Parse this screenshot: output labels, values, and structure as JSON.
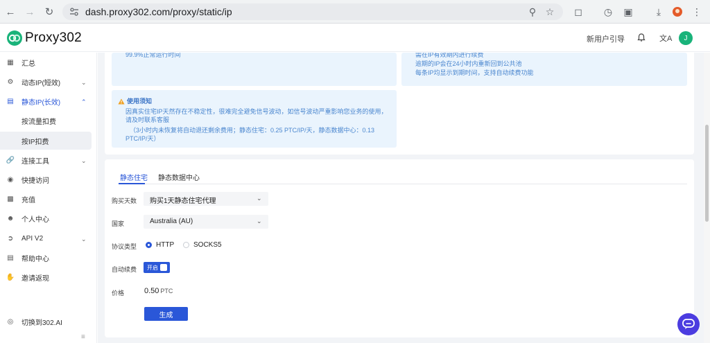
{
  "browser": {
    "url": "dash.proxy302.com/proxy/static/ip"
  },
  "header": {
    "logo_text": "Proxy302",
    "guide_label": "新用户引导",
    "lang_label": "文A",
    "avatar_letter": "J"
  },
  "sidebar": {
    "items": [
      {
        "label": "汇总"
      },
      {
        "label": "动态IP(短效)"
      },
      {
        "label": "静态IP(长效)"
      },
      {
        "label": "连接工具"
      },
      {
        "label": "快捷访问"
      },
      {
        "label": "充值"
      },
      {
        "label": "个人中心"
      },
      {
        "label": "API V2"
      },
      {
        "label": "帮助中心"
      },
      {
        "label": "邀请返现"
      }
    ],
    "sub_items": [
      {
        "label": "按流量扣费"
      },
      {
        "label": "按IP扣费"
      }
    ],
    "switch_label": "切换到302.AI"
  },
  "info": {
    "uptime": "99.9%正常运行时间",
    "right_lines": [
      "需在IP有效期内进行续费",
      "逾期的IP会在24小时内重新回到公共池",
      "每条IP均显示到期时间，支持自动续费功能"
    ],
    "notice_title": "使用须知",
    "notice_lines": [
      "因真实住宅IP天然存在不稳定性，很难完全避免信号波动，如信号波动严重影响您业务的使用，",
      "请及时联系客服",
      "（3小时内未恢复将自动退还剩余费用；静态住宅：0.25 PTC/IP/天，静态数据中心：0.13",
      "PTC/IP/天）"
    ]
  },
  "form": {
    "tabs": [
      {
        "label": "静态住宅",
        "active": true
      },
      {
        "label": "静态数据中心",
        "active": false
      }
    ],
    "days_label": "购买天数",
    "days_value": "购买1天静态住宅代理",
    "country_label": "国家",
    "country_value": "Australia (AU)",
    "protocol_label": "协议类型",
    "protocol_options": [
      {
        "label": "HTTP",
        "selected": true
      },
      {
        "label": "SOCKS5",
        "selected": false
      }
    ],
    "auto_renew_label": "自动续费",
    "auto_renew_state": "开启",
    "price_label": "价格",
    "price_value": "0.50",
    "price_unit": "PTC",
    "generate_label": "生成"
  },
  "colors": {
    "accent": "#2a57d8",
    "info_bg": "#eaf4fd",
    "info_text": "#4a86cf",
    "logo_green": "#19b37a",
    "chat_fab": "#4b3ce0"
  }
}
